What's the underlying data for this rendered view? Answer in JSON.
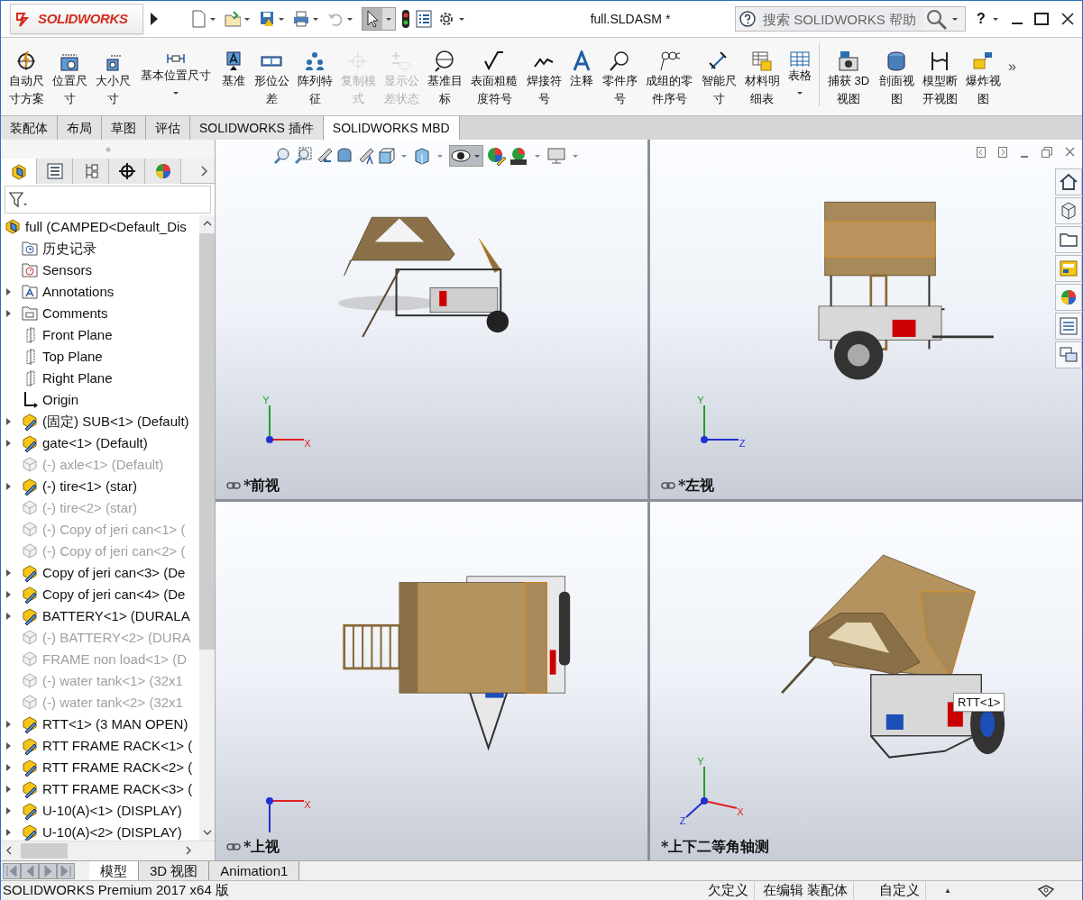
{
  "title_bar": {
    "logo": "SOLIDWORKS",
    "title": "full.SLDASM *",
    "search_placeholder": "搜索 SOLIDWORKS 帮助",
    "help": "?"
  },
  "ribbon": [
    {
      "label": "自动尺寸方案",
      "kind": "button",
      "disabled": false
    },
    {
      "label": "位置尺寸",
      "kind": "button",
      "disabled": false
    },
    {
      "label": "大小尺寸",
      "kind": "button",
      "disabled": false
    },
    {
      "label": "基本位置尺寸",
      "kind": "dropdown",
      "disabled": false
    },
    {
      "label": "基准",
      "kind": "button",
      "disabled": false
    },
    {
      "label": "形位公差",
      "kind": "button",
      "disabled": false
    },
    {
      "label": "阵列特征",
      "kind": "button",
      "disabled": false
    },
    {
      "label": "复制模式",
      "kind": "button",
      "disabled": true
    },
    {
      "label": "显示公差状态",
      "kind": "button",
      "disabled": true
    },
    {
      "label": "基准目标",
      "kind": "button",
      "disabled": false
    },
    {
      "label": "表面粗糙度符号",
      "kind": "button",
      "disabled": false
    },
    {
      "label": "焊接符号",
      "kind": "button",
      "disabled": false
    },
    {
      "label": "注释",
      "kind": "button",
      "disabled": false
    },
    {
      "label": "零件序号",
      "kind": "button",
      "disabled": false
    },
    {
      "label": "成组的零件序号",
      "kind": "button",
      "disabled": false
    },
    {
      "label": "智能尺寸",
      "kind": "button",
      "disabled": false
    },
    {
      "label": "材料明细表",
      "kind": "button",
      "disabled": false
    },
    {
      "label": "表格",
      "kind": "dropdown",
      "disabled": false
    },
    {
      "label": "捕获 3D 视图",
      "kind": "button",
      "disabled": false
    },
    {
      "label": "剖面视图",
      "kind": "button",
      "disabled": false
    },
    {
      "label": "模型断开视图",
      "kind": "button",
      "disabled": false
    },
    {
      "label": "爆炸视图",
      "kind": "button",
      "disabled": false
    }
  ],
  "ribbon_more": "»",
  "command_tabs": [
    {
      "label": "装配体",
      "selected": false
    },
    {
      "label": "布局",
      "selected": false
    },
    {
      "label": "草图",
      "selected": false
    },
    {
      "label": "评估",
      "selected": false
    },
    {
      "label": "SOLIDWORKS 插件",
      "selected": false
    },
    {
      "label": "SOLIDWORKS MBD",
      "selected": true
    }
  ],
  "panel_tabs": [
    {
      "selected": true
    },
    {
      "selected": false
    },
    {
      "selected": false
    },
    {
      "selected": false
    },
    {
      "selected": false
    }
  ],
  "tree": [
    {
      "label": "full  (CAMPED<Default_Dis",
      "kind": "root",
      "suppressed": false
    },
    {
      "label": "历史记录",
      "kind": "history",
      "expandable": false,
      "suppressed": false
    },
    {
      "label": "Sensors",
      "kind": "sensors",
      "expandable": false,
      "suppressed": false
    },
    {
      "label": "Annotations",
      "kind": "annotations",
      "expandable": true,
      "suppressed": false
    },
    {
      "label": "Comments",
      "kind": "comments",
      "expandable": true,
      "suppressed": false
    },
    {
      "label": "Front Plane",
      "kind": "plane",
      "expandable": false,
      "suppressed": false
    },
    {
      "label": "Top Plane",
      "kind": "plane",
      "expandable": false,
      "suppressed": false
    },
    {
      "label": "Right Plane",
      "kind": "plane",
      "expandable": false,
      "suppressed": false
    },
    {
      "label": "Origin",
      "kind": "origin",
      "expandable": false,
      "suppressed": false
    },
    {
      "label": "(固定) SUB<1> (Default)",
      "kind": "assembly",
      "expandable": true,
      "suppressed": false
    },
    {
      "label": "gate<1> (Default)",
      "kind": "assembly",
      "expandable": true,
      "suppressed": false
    },
    {
      "label": "(-) axle<1> (Default)",
      "kind": "part",
      "expandable": false,
      "suppressed": true
    },
    {
      "label": "(-) tire<1> (star)",
      "kind": "assembly",
      "expandable": true,
      "suppressed": false
    },
    {
      "label": "(-) tire<2> (star)",
      "kind": "part",
      "expandable": false,
      "suppressed": true
    },
    {
      "label": "(-) Copy of jeri can<1> (",
      "kind": "part",
      "expandable": false,
      "suppressed": true
    },
    {
      "label": "(-) Copy of jeri can<2> (",
      "kind": "part",
      "expandable": false,
      "suppressed": true
    },
    {
      "label": "Copy of jeri can<3> (De",
      "kind": "assembly",
      "expandable": true,
      "suppressed": false
    },
    {
      "label": "Copy of jeri can<4> (De",
      "kind": "assembly",
      "expandable": true,
      "suppressed": false
    },
    {
      "label": "BATTERY<1> (DURALA",
      "kind": "assembly",
      "expandable": true,
      "suppressed": false
    },
    {
      "label": "(-) BATTERY<2> (DURA",
      "kind": "part",
      "expandable": false,
      "suppressed": true
    },
    {
      "label": "FRAME non load<1> (D",
      "kind": "part",
      "expandable": false,
      "suppressed": true
    },
    {
      "label": "(-) water tank<1> (32x1",
      "kind": "part",
      "expandable": false,
      "suppressed": true
    },
    {
      "label": "(-) water tank<2> (32x1",
      "kind": "part",
      "expandable": false,
      "suppressed": true
    },
    {
      "label": "RTT<1> (3 MAN OPEN)",
      "kind": "assembly",
      "expandable": true,
      "suppressed": false
    },
    {
      "label": "RTT FRAME RACK<1> (",
      "kind": "assembly",
      "expandable": true,
      "suppressed": false
    },
    {
      "label": "RTT FRAME RACK<2> (",
      "kind": "assembly",
      "expandable": true,
      "suppressed": false
    },
    {
      "label": "RTT FRAME RACK<3> (",
      "kind": "assembly",
      "expandable": true,
      "suppressed": false
    },
    {
      "label": "U-10(A)<1> (DISPLAY)",
      "kind": "assembly",
      "expandable": true,
      "suppressed": false
    },
    {
      "label": "U-10(A)<2> (DISPLAY)",
      "kind": "assembly",
      "expandable": true,
      "suppressed": false
    }
  ],
  "bottom_tabs": [
    {
      "label": "模型",
      "selected": true
    },
    {
      "label": "3D 视图",
      "selected": false
    },
    {
      "label": "Animation1",
      "selected": false
    }
  ],
  "viewports": [
    {
      "label": "*前视",
      "kind": "front",
      "linked": true,
      "axes": [
        {
          "kind": "y",
          "label": "Y"
        },
        {
          "kind": "x",
          "label": "X"
        }
      ]
    },
    {
      "label": "*左视",
      "kind": "left",
      "linked": true,
      "axes": [
        {
          "kind": "y",
          "label": "Y"
        },
        {
          "kind": "z",
          "label": "Z"
        }
      ]
    },
    {
      "label": "*上视",
      "kind": "top",
      "linked": true,
      "axes": [
        {
          "kind": "x",
          "label": "X"
        }
      ]
    },
    {
      "label": "*上下二等角轴测",
      "kind": "iso",
      "linked": false,
      "axes": [
        {
          "kind": "y",
          "label": "Y"
        },
        {
          "kind": "x",
          "label": "X"
        },
        {
          "kind": "z",
          "label": "Z"
        }
      ],
      "tooltip": "RTT<1>"
    }
  ],
  "status_bar": {
    "product": "SOLIDWORKS Premium 2017 x64 版",
    "items": [
      "欠定义",
      "在编辑 装配体",
      "自定义"
    ],
    "caret": "▲"
  }
}
